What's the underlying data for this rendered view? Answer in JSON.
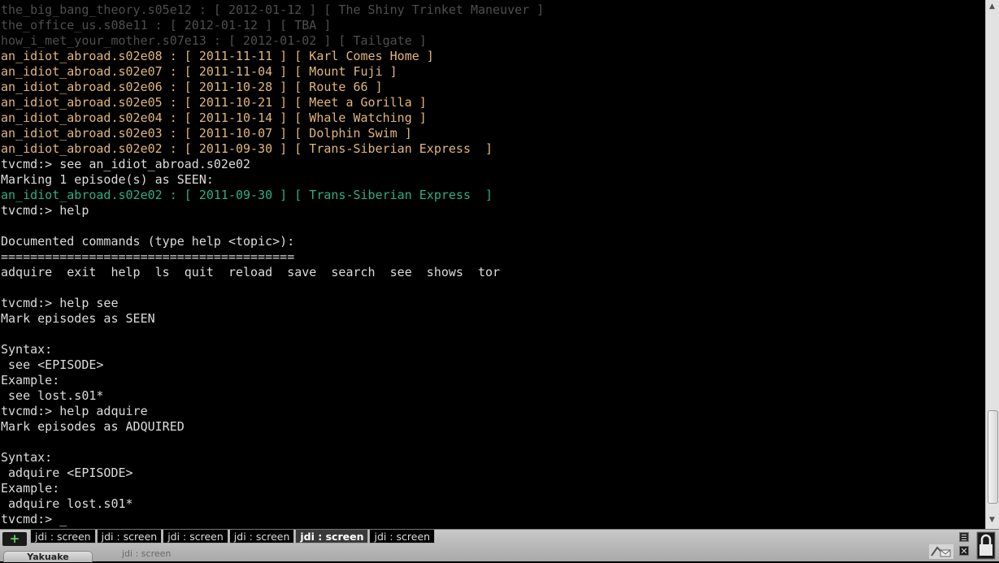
{
  "terminal": {
    "lines": [
      {
        "text": "the_big_bang_theory.s05e12 : [ 2012-01-12 ] [ The Shiny Trinket Maneuver ]",
        "color": "#4e4e4e"
      },
      {
        "text": "the_office_us.s08e11 : [ 2012-01-12 ] [ TBA ]",
        "color": "#4e4e4e"
      },
      {
        "text": "how_i_met_your_mother.s07e13 : [ 2012-01-02 ] [ Tailgate ]",
        "color": "#4e4e4e"
      },
      {
        "text": "an_idiot_abroad.s02e08 : [ 2011-11-11 ] [ Karl Comes Home ]",
        "color": "#e1b67a"
      },
      {
        "text": "an_idiot_abroad.s02e07 : [ 2011-11-04 ] [ Mount Fuji ]",
        "color": "#e1b67a"
      },
      {
        "text": "an_idiot_abroad.s02e06 : [ 2011-10-28 ] [ Route 66 ]",
        "color": "#e1b67a"
      },
      {
        "text": "an_idiot_abroad.s02e05 : [ 2011-10-21 ] [ Meet a Gorilla ]",
        "color": "#e1b67a"
      },
      {
        "text": "an_idiot_abroad.s02e04 : [ 2011-10-14 ] [ Whale Watching ]",
        "color": "#e1b67a"
      },
      {
        "text": "an_idiot_abroad.s02e03 : [ 2011-10-07 ] [ Dolphin Swim ]",
        "color": "#e1b67a"
      },
      {
        "text": "an_idiot_abroad.s02e02 : [ 2011-09-30 ] [ Trans-Siberian Express  ]",
        "color": "#e1b67a"
      },
      {
        "text": "tvcmd:> see an_idiot_abroad.s02e02",
        "color": "#dcdcdc"
      },
      {
        "text": "Marking 1 episode(s) as SEEN:",
        "color": "#dcdcdc"
      },
      {
        "text": "an_idiot_abroad.s02e02 : [ 2011-09-30 ] [ Trans-Siberian Express  ]",
        "color": "#2fae84"
      },
      {
        "text": "tvcmd:> help",
        "color": "#dcdcdc"
      },
      {
        "text": "",
        "color": "#dcdcdc"
      },
      {
        "text": "Documented commands (type help <topic>):",
        "color": "#dcdcdc"
      },
      {
        "text": "========================================",
        "color": "#dcdcdc"
      },
      {
        "text": "adquire  exit  help  ls  quit  reload  save  search  see  shows  tor",
        "color": "#dcdcdc"
      },
      {
        "text": "",
        "color": "#dcdcdc"
      },
      {
        "text": "tvcmd:> help see",
        "color": "#dcdcdc"
      },
      {
        "text": "Mark episodes as SEEN",
        "color": "#dcdcdc"
      },
      {
        "text": "",
        "color": "#dcdcdc"
      },
      {
        "text": "Syntax:",
        "color": "#dcdcdc"
      },
      {
        "text": " see <EPISODE>",
        "color": "#dcdcdc"
      },
      {
        "text": "Example:",
        "color": "#dcdcdc"
      },
      {
        "text": " see lost.s01*",
        "color": "#dcdcdc"
      },
      {
        "text": "tvcmd:> help adquire",
        "color": "#dcdcdc"
      },
      {
        "text": "Mark episodes as ADQUIRED",
        "color": "#dcdcdc"
      },
      {
        "text": "",
        "color": "#dcdcdc"
      },
      {
        "text": "Syntax:",
        "color": "#dcdcdc"
      },
      {
        "text": " adquire <EPISODE>",
        "color": "#dcdcdc"
      },
      {
        "text": "Example:",
        "color": "#dcdcdc"
      },
      {
        "text": " adquire lost.s01*",
        "color": "#dcdcdc"
      },
      {
        "text": "tvcmd:> _",
        "color": "#dcdcdc"
      }
    ]
  },
  "tabbar": {
    "new_tab_icon": "+",
    "tabs": [
      {
        "label": "jdi : screen",
        "active": false
      },
      {
        "label": "jdi : screen",
        "active": false
      },
      {
        "label": "jdi : screen",
        "active": false
      },
      {
        "label": "jdi : screen",
        "active": false
      },
      {
        "label": "jdi : screen",
        "active": true
      },
      {
        "label": "jdi : screen",
        "active": false
      }
    ],
    "app_label": "Yakuake",
    "session_title": "jdi : screen",
    "close_icon": "✕"
  },
  "scrollbar": {
    "up_arrow": "▲",
    "down_arrow": "▼"
  },
  "colors": {
    "background": "#000000",
    "dim": "#4e4e4e",
    "orange": "#e1b67a",
    "green": "#2fae84",
    "normal": "#dcdcdc"
  }
}
